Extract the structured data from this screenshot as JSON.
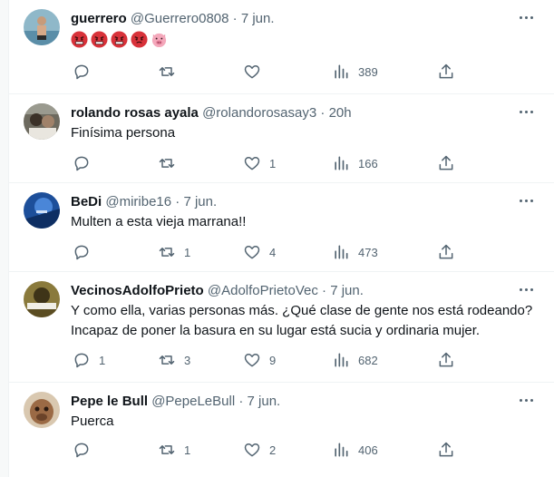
{
  "tweets": [
    {
      "name": "guerrero",
      "handle": "@Guerrero0808",
      "time": "7 jun.",
      "text": "",
      "emojis": [
        "angry-face-icon",
        "angry-face-icon",
        "angry-face-icon",
        "angry-face-icon",
        "pig-face-icon"
      ],
      "reply_count": "",
      "retweet_count": "",
      "like_count": "",
      "views": "389"
    },
    {
      "name": "rolando rosas ayala",
      "handle": "@rolandorosasay3",
      "time": "20h",
      "text": "Finísima persona",
      "reply_count": "",
      "retweet_count": "",
      "like_count": "1",
      "views": "166"
    },
    {
      "name": "BeDi",
      "handle": "@miribe16",
      "time": "7 jun.",
      "text": "Multen a esta vieja marrana!!",
      "reply_count": "",
      "retweet_count": "1",
      "like_count": "4",
      "views": "473"
    },
    {
      "name": "VecinosAdolfoPrieto",
      "handle": "@AdolfoPrietoVec",
      "time": "7 jun.",
      "text_lines": [
        "Y como ella, varias personas más. ¿Qué clase de gente nos está rodeando?",
        "Incapaz de poner la basura en su lugar está sucia y ordinaria mujer."
      ],
      "reply_count": "1",
      "retweet_count": "3",
      "like_count": "9",
      "views": "682"
    },
    {
      "name": "Pepe le Bull",
      "handle": "@PepeLeBull",
      "time": "7 jun.",
      "text": "Puerca",
      "reply_count": "",
      "retweet_count": "1",
      "like_count": "2",
      "views": "406"
    }
  ],
  "colors": {
    "text": "#0f1419",
    "secondary": "#536471",
    "divider": "#eff3f4",
    "angry": "#d8323a"
  }
}
